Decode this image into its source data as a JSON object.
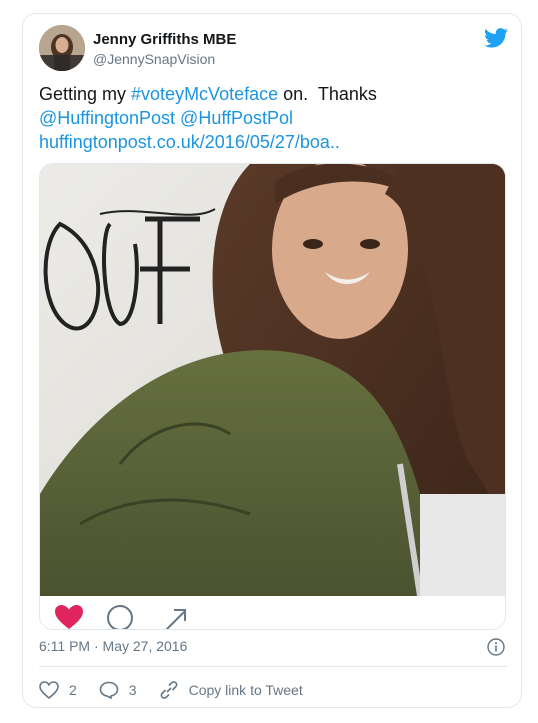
{
  "author": {
    "name": "Jenny Griffiths MBE",
    "handle": "@JennySnapVision"
  },
  "tweet": {
    "text_plain": "Getting my ",
    "hashtag": "#voteyMcVoteface",
    "text_after": " on.  Thanks",
    "mention_1": "@HuffingtonPost",
    "mention_2": "@HuffPostPol",
    "url": "huffingtonpost.co.uk/2016/05/27/boa.."
  },
  "meta": {
    "timestamp": "6:11 PM · May 27, 2016"
  },
  "actions": {
    "likes": "2",
    "replies": "3",
    "copy_link": "Copy link to Tweet"
  },
  "colors": {
    "link": "#1b95e0",
    "twitter_blue": "#1da1f2",
    "like_red": "#e0245e"
  }
}
